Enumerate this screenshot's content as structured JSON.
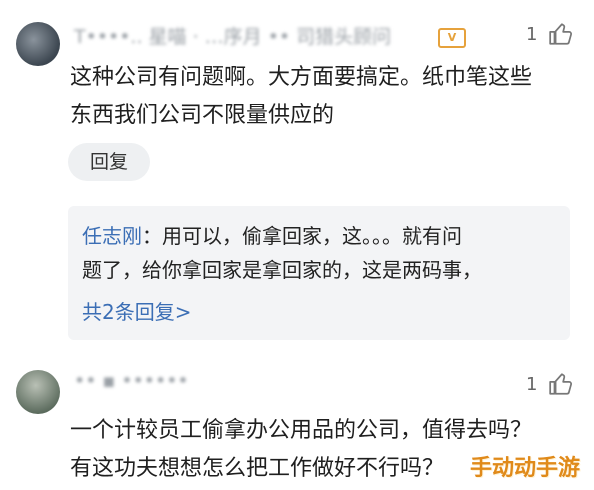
{
  "comments": [
    {
      "username": "T••••.. 星喵 · …序月 •• 司猎头顾问",
      "badge": "V",
      "likes": "1",
      "lines": [
        "这种公司有问题啊。大方面要搞定。纸巾笔这些",
        "东西我们公司不限量供应的"
      ],
      "reply_label": "回复",
      "reply_preview": {
        "author": "任志刚",
        "separator": "：",
        "line1": "用可以，偷拿回家，这。。。就有问",
        "line2": "题了，给你拿回家是拿回家的，这是两码事，",
        "more_label": "共2条回复>"
      }
    },
    {
      "username": "•• ▪ ••••••",
      "likes": "1",
      "lines": [
        "一个计较员工偷拿办公用品的公司，值得去吗？",
        "有这功夫想想怎么把工作做好不行吗？"
      ]
    }
  ],
  "watermark": "手动动手游",
  "icons": {
    "like": "thumbs-up-icon",
    "verify": "verified-badge-icon"
  }
}
